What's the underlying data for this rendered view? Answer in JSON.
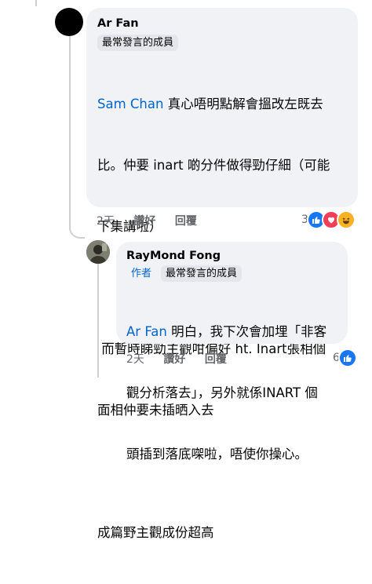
{
  "comment": {
    "author": "Ar Fan",
    "badge": "最常發言的成員",
    "mention": "Sam Chan",
    "text_line1": " 真心唔明點解會搵改左既去",
    "text_line2": "比。仲要 inart 啲分件做得勁仔細（可能",
    "text_line3": "下集講啦）",
    "text_line4": "",
    "text_line5": " 而暫時睇勁主觀咁偏好 ht. Inart張相個",
    "text_line6": "面相仲要未插晒入去",
    "text_line7": "",
    "text_line8": "成篇野主觀成份超高",
    "time": "2天",
    "like_label": "讚好",
    "reply_label": "回覆",
    "reaction_count": "3",
    "reactions": [
      "like",
      "love",
      "haha"
    ]
  },
  "reply": {
    "author": "RayMond Fong",
    "author_badge": "作者",
    "badge": "最常發言的成員",
    "mention": "Ar Fan",
    "text_line1": " 明白，我下次會加埋「非客",
    "text_line2": "觀分析落去」，另外就係INART 個",
    "text_line3": "頭插到落底㗎啦，唔使你操心。",
    "time": "2天",
    "like_label": "讚好",
    "reply_label": "回覆",
    "reaction_count": "6",
    "reactions": [
      "like"
    ]
  },
  "colors": {
    "like": "#1877f2",
    "love": "#f33e58",
    "haha": "#f7b125",
    "link": "#0064d1",
    "bubble": "#f0f2f5"
  }
}
